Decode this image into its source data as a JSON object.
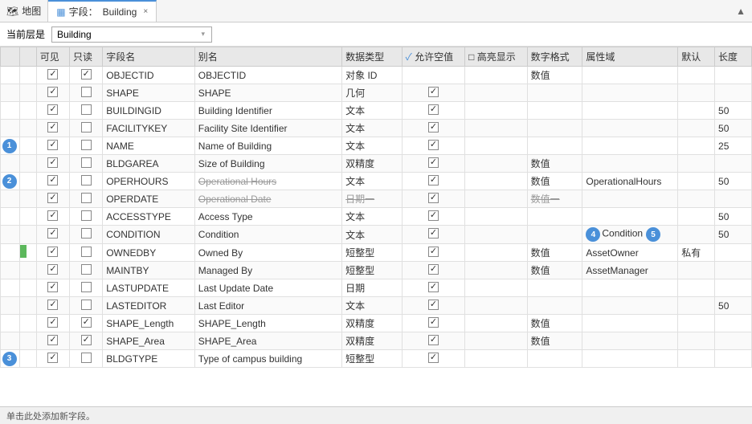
{
  "topbar": {
    "map_label": "地图",
    "fields_tab_label": "字段：",
    "fields_tab_name": "Building",
    "close_icon": "×"
  },
  "layer_row": {
    "label": "当前层是",
    "selected": "Building",
    "dropdown_arrow": "▾"
  },
  "table": {
    "headers": [
      {
        "key": "arrow",
        "label": ""
      },
      {
        "key": "visible",
        "label": "可见"
      },
      {
        "key": "readonly",
        "label": "只读"
      },
      {
        "key": "fieldname",
        "label": "字段名"
      },
      {
        "key": "alias",
        "label": "别名"
      },
      {
        "key": "datatype",
        "label": "数据类型"
      },
      {
        "key": "allownull",
        "label": "✓ 允许空值"
      },
      {
        "key": "highlight",
        "label": "□ 高亮显示"
      },
      {
        "key": "numformat",
        "label": "数字格式"
      },
      {
        "key": "domain",
        "label": "属性域"
      },
      {
        "key": "default",
        "label": "默认"
      },
      {
        "key": "length",
        "label": "长度"
      }
    ],
    "rows": [
      {
        "badge": "",
        "green": false,
        "arrow": "",
        "visible": true,
        "readonly": true,
        "fieldname": "OBJECTID",
        "alias": "OBJECTID",
        "datatype": "对象 ID",
        "allownull": false,
        "highlight": false,
        "numformat": "数值",
        "domain": "",
        "default": "",
        "length": ""
      },
      {
        "badge": "",
        "green": false,
        "arrow": "",
        "visible": true,
        "readonly": false,
        "fieldname": "SHAPE",
        "alias": "SHAPE",
        "datatype": "几何",
        "allownull": true,
        "highlight": false,
        "numformat": "",
        "domain": "",
        "default": "",
        "length": ""
      },
      {
        "badge": "",
        "green": false,
        "arrow": "",
        "visible": true,
        "readonly": false,
        "fieldname": "BUILDINGID",
        "alias": "Building Identifier",
        "datatype": "文本",
        "allownull": true,
        "highlight": false,
        "numformat": "",
        "domain": "",
        "default": "",
        "length": "50"
      },
      {
        "badge": "",
        "green": false,
        "arrow": "",
        "visible": true,
        "readonly": false,
        "fieldname": "FACILITYKEY",
        "alias": "Facility Site Identifier",
        "datatype": "文本",
        "allownull": true,
        "highlight": false,
        "numformat": "",
        "domain": "",
        "default": "",
        "length": "50"
      },
      {
        "badge": "1",
        "green": false,
        "arrow": "",
        "visible": true,
        "readonly": false,
        "fieldname": "NAME",
        "alias": "Name of Building",
        "datatype": "文本",
        "allownull": true,
        "highlight": false,
        "numformat": "",
        "domain": "",
        "default": "",
        "length": "25"
      },
      {
        "badge": "",
        "green": false,
        "arrow": "",
        "visible": true,
        "readonly": false,
        "fieldname": "BLDGAREA",
        "alias": "Size of Building",
        "datatype": "双精度",
        "allownull": true,
        "highlight": false,
        "numformat": "数值",
        "domain": "",
        "default": "",
        "length": ""
      },
      {
        "badge": "2",
        "green": false,
        "arrow": "",
        "visible": true,
        "readonly": false,
        "fieldname": "OPERHOURS",
        "alias": "Operational Hours",
        "datatype": "文本",
        "allownull": true,
        "highlight": false,
        "numformat": "数值",
        "domain": "OperationalHours",
        "default": "",
        "length": "50",
        "strikethrough_alias": true
      },
      {
        "badge": "",
        "green": false,
        "arrow": "",
        "visible": true,
        "readonly": false,
        "fieldname": "OPERDATE",
        "alias": "Operational Date",
        "datatype": "日期一",
        "allownull": true,
        "highlight": false,
        "numformat": "数值一",
        "domain": "",
        "default": "",
        "length": "",
        "strikethrough_alias": true,
        "strikethrough_datatype": true,
        "strikethrough_numformat": true
      },
      {
        "badge": "",
        "green": false,
        "arrow": "",
        "visible": true,
        "readonly": false,
        "fieldname": "ACCESSTYPE",
        "alias": "Access Type",
        "datatype": "文本",
        "allownull": true,
        "highlight": false,
        "numformat": "",
        "domain": "",
        "default": "",
        "length": "50"
      },
      {
        "badge": "",
        "green": false,
        "arrow": "",
        "visible": true,
        "readonly": false,
        "fieldname": "CONDITION",
        "alias": "Condition",
        "datatype": "文本",
        "allownull": true,
        "highlight": false,
        "numformat": "",
        "domain": "Condition",
        "domain_badge": "4",
        "default": "",
        "length": "50",
        "badge5": "5"
      },
      {
        "badge": "",
        "green": true,
        "arrow": "",
        "visible": true,
        "readonly": false,
        "fieldname": "OWNEDBY",
        "alias": "Owned By",
        "datatype": "短整型",
        "allownull": true,
        "highlight": false,
        "numformat": "数值",
        "domain": "AssetOwner",
        "default": "私有",
        "length": ""
      },
      {
        "badge": "",
        "green": false,
        "arrow": "",
        "visible": true,
        "readonly": false,
        "fieldname": "MAINTBY",
        "alias": "Managed By",
        "datatype": "短整型",
        "allownull": true,
        "highlight": false,
        "numformat": "数值",
        "domain": "AssetManager",
        "default": "",
        "length": ""
      },
      {
        "badge": "",
        "green": false,
        "arrow": "",
        "visible": true,
        "readonly": false,
        "fieldname": "LASTUPDATE",
        "alias": "Last Update Date",
        "datatype": "日期",
        "allownull": true,
        "highlight": false,
        "numformat": "",
        "domain": "",
        "default": "",
        "length": ""
      },
      {
        "badge": "",
        "green": false,
        "arrow": "",
        "visible": true,
        "readonly": false,
        "fieldname": "LASTEDITOR",
        "alias": "Last Editor",
        "datatype": "文本",
        "allownull": true,
        "highlight": false,
        "numformat": "",
        "domain": "",
        "default": "",
        "length": "50"
      },
      {
        "badge": "",
        "green": false,
        "arrow": "",
        "visible": true,
        "readonly": true,
        "fieldname": "SHAPE_Length",
        "alias": "SHAPE_Length",
        "datatype": "双精度",
        "allownull": true,
        "highlight": false,
        "numformat": "数值",
        "domain": "",
        "default": "",
        "length": ""
      },
      {
        "badge": "",
        "green": false,
        "arrow": "",
        "visible": true,
        "readonly": true,
        "fieldname": "SHAPE_Area",
        "alias": "SHAPE_Area",
        "datatype": "双精度",
        "allownull": true,
        "highlight": false,
        "numformat": "数值",
        "domain": "",
        "default": "",
        "length": ""
      },
      {
        "badge": "3",
        "green": false,
        "arrow": "",
        "visible": true,
        "readonly": false,
        "fieldname": "BLDGTYPE",
        "alias": "Type of campus building",
        "datatype": "短整型",
        "allownull": true,
        "highlight": false,
        "numformat": "",
        "domain": "",
        "default": "",
        "length": ""
      }
    ]
  },
  "status_bar": {
    "text": "单击此处添加新字段。"
  }
}
